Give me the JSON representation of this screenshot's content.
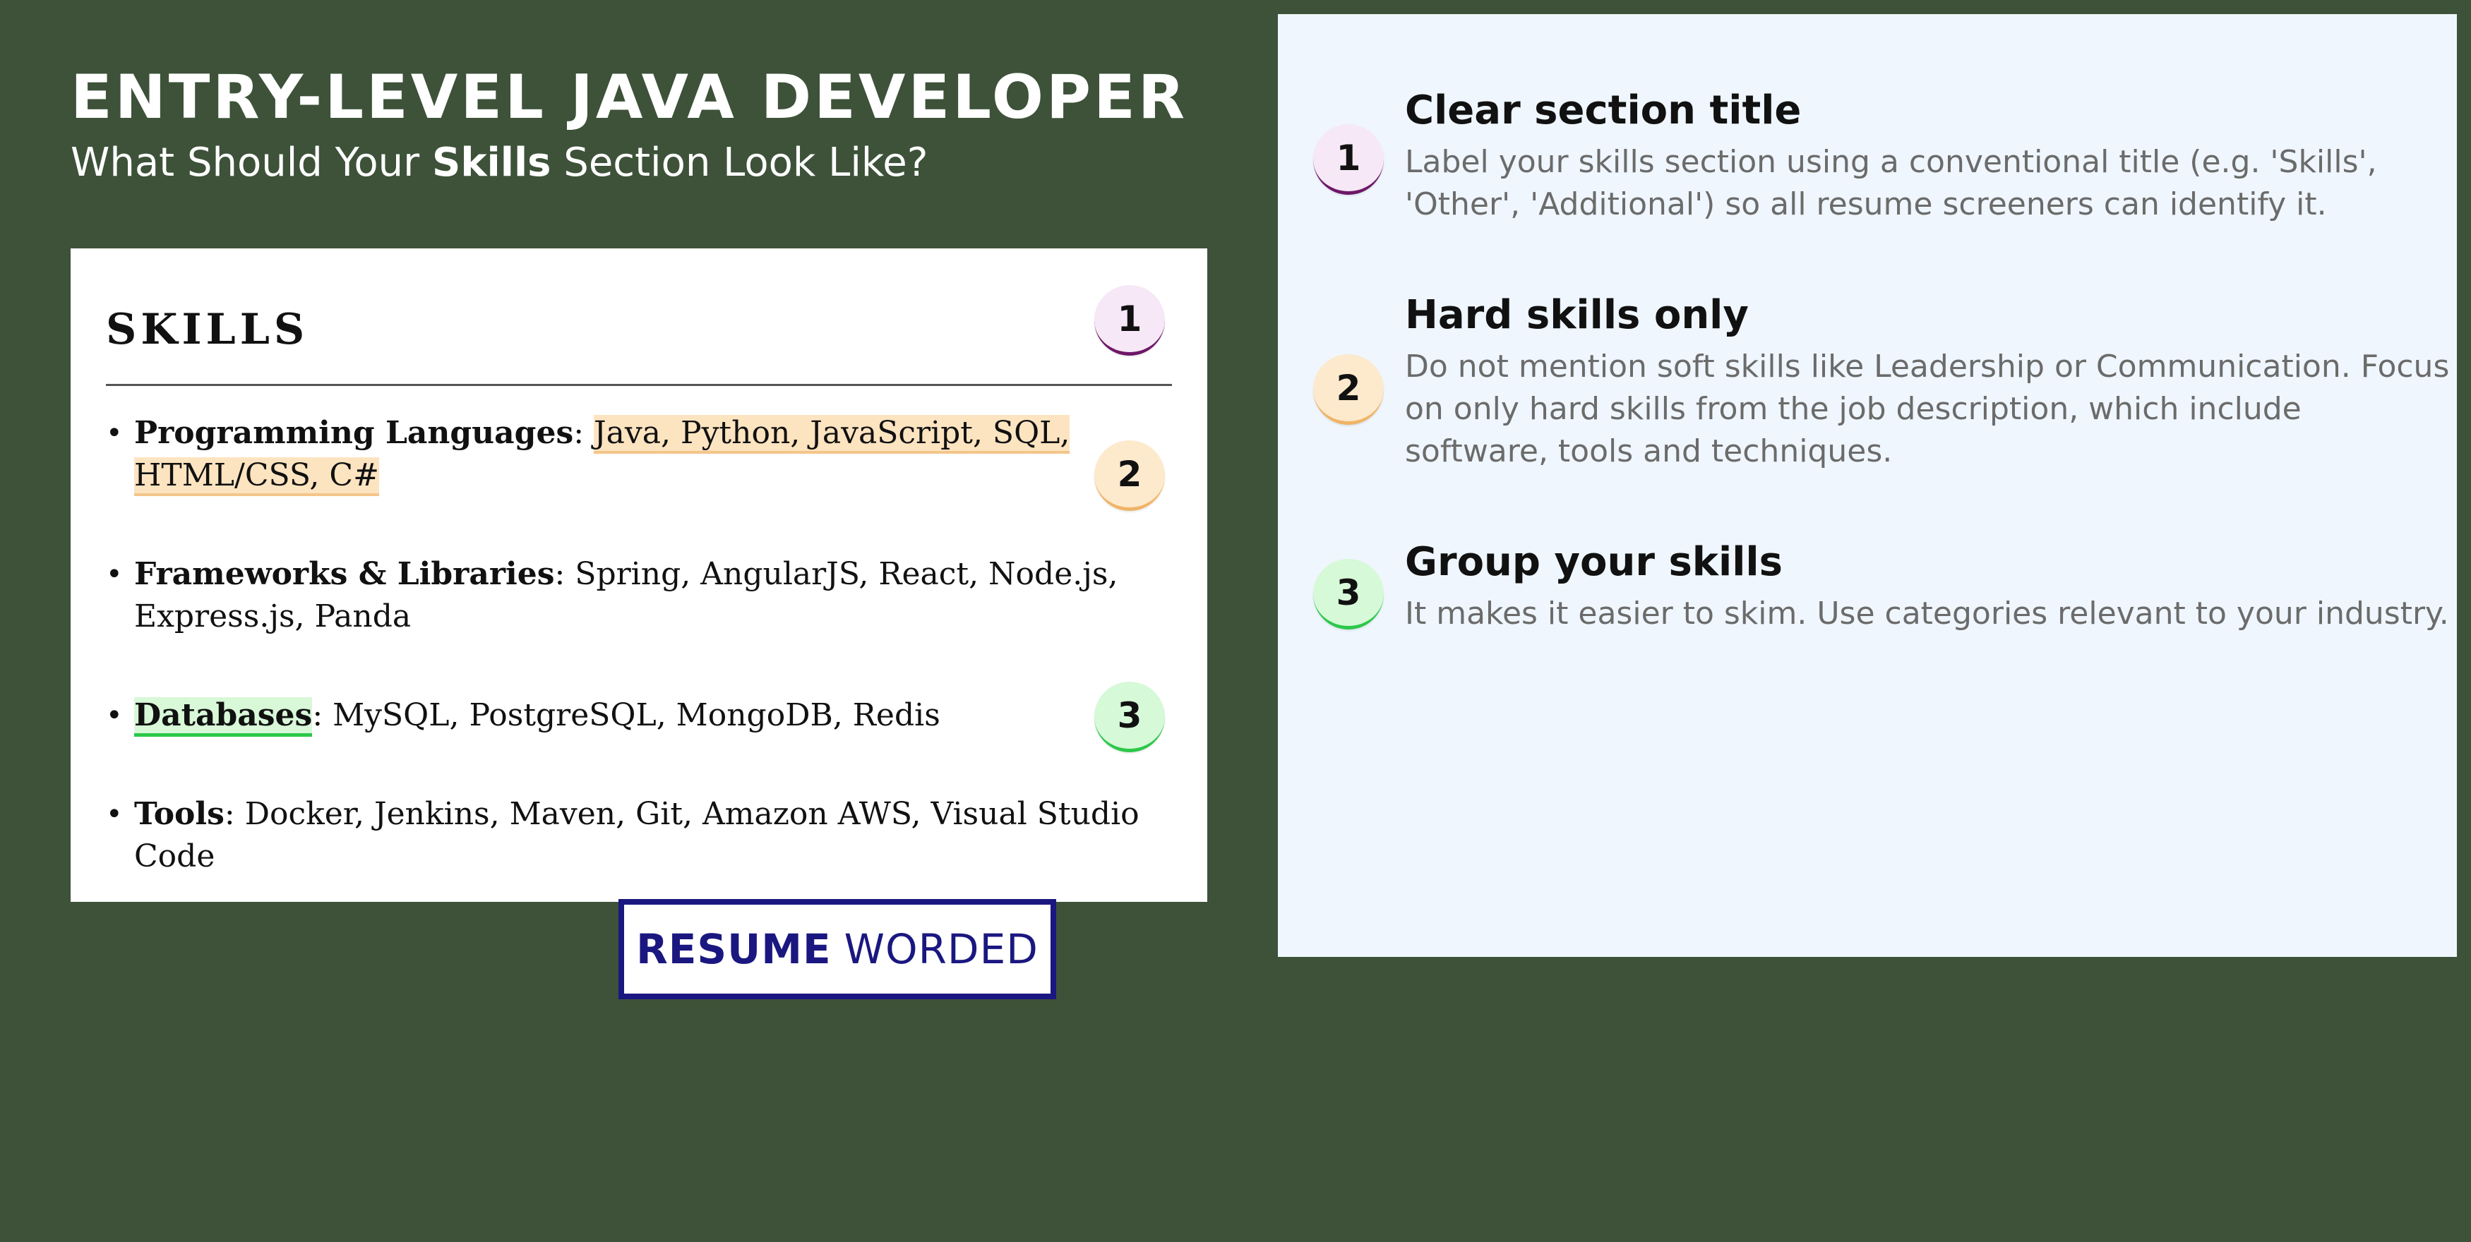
{
  "header": {
    "title": "ENTRY-LEVEL JAVA DEVELOPER",
    "subtitle_before": "What Should Your ",
    "subtitle_bold": "Skills",
    "subtitle_after": " Section Look Like?"
  },
  "resume": {
    "section_title": "SKILLS",
    "items": [
      {
        "label": "Programming Languages",
        "separator": ": ",
        "value": "Java, Python, JavaScript, SQL, HTML/CSS, C#",
        "highlight": "value"
      },
      {
        "label": "Frameworks & Libraries",
        "separator": ": ",
        "value": "Spring, AngularJS, React, Node.js, Express.js, Panda",
        "highlight": "none"
      },
      {
        "label": "Databases",
        "separator": ": ",
        "value": "MySQL, PostgreSQL, MongoDB, Redis",
        "highlight": "label"
      },
      {
        "label": "Tools",
        "separator": ": ",
        "value": "Docker, Jenkins, Maven, Git, Amazon AWS, Visual Studio Code",
        "highlight": "none"
      }
    ],
    "markers": [
      "1",
      "2",
      "3"
    ]
  },
  "brand": {
    "bold": "RESUME",
    "regular": "WORDED"
  },
  "tips": [
    {
      "number": "1",
      "title": "Clear section title",
      "description": "Label your skills section using a conventional title (e.g. 'Skills', 'Other', 'Additional') so all resume screeners can identify it."
    },
    {
      "number": "2",
      "title": "Hard skills only",
      "description": "Do not mention soft skills like Leadership or Communication. Focus on only hard skills from the job description, which include software, tools and techniques."
    },
    {
      "number": "3",
      "title": "Group your skills",
      "description": "It makes it easier to skim. Use categories relevant to your industry."
    }
  ],
  "colors": {
    "background": "#3d5239",
    "marker_1": "#6e1768",
    "marker_2": "#f0b466",
    "marker_3": "#2cc84a",
    "brand": "#1b1780"
  }
}
